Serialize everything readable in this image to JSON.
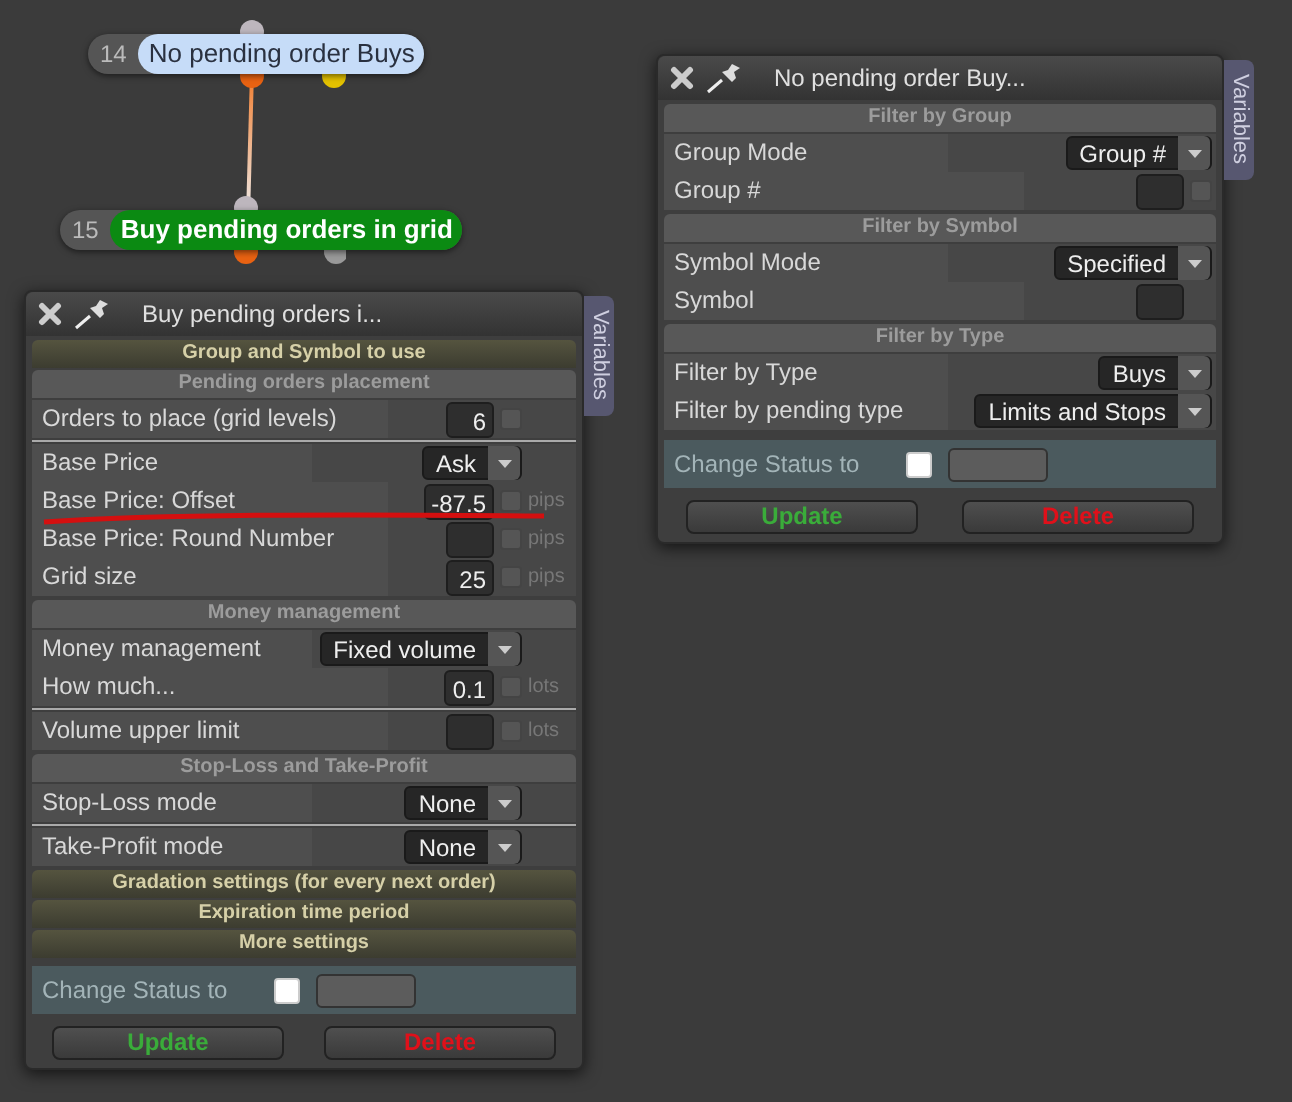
{
  "nodes": [
    {
      "number": "14",
      "label": "No pending order Buys",
      "kind": "condition"
    },
    {
      "number": "15",
      "label": "Buy pending orders in grid",
      "kind": "action"
    }
  ],
  "dialogs": [
    {
      "title": "Buy pending orders i...",
      "side_tab": "Variables",
      "sections": [
        {
          "heading": "Group and Symbol to use",
          "expanded": false
        },
        {
          "heading": "Pending orders placement",
          "expanded": true,
          "groups": [
            [
              {
                "kind": "number",
                "label": "Orders to place (grid levels)",
                "value": "6",
                "checked": false
              }
            ],
            [
              {
                "kind": "select",
                "label": "Base Price",
                "value": "Ask"
              },
              {
                "kind": "number",
                "label": "Base Price: Offset",
                "value": "-87.5",
                "checked": false,
                "unit": "pips"
              },
              {
                "kind": "number",
                "label": "Base Price: Round Number",
                "checked": false,
                "unit": "pips"
              },
              {
                "kind": "number",
                "label": "Grid size",
                "value": "25",
                "checked": false,
                "unit": "pips"
              }
            ]
          ]
        },
        {
          "heading": "Money management",
          "expanded": true,
          "groups": [
            [
              {
                "kind": "select",
                "label": "Money management",
                "value": "Fixed volume"
              },
              {
                "kind": "number",
                "label": "How much...",
                "value": "0.1",
                "checked": false,
                "unit": "lots"
              }
            ],
            [
              {
                "kind": "number",
                "label": "Volume upper limit",
                "checked": false,
                "unit": "lots"
              }
            ]
          ]
        },
        {
          "heading": "Stop-Loss and Take-Profit",
          "expanded": true,
          "groups": [
            [
              {
                "kind": "select",
                "label": "Stop-Loss mode",
                "value": "None"
              }
            ],
            [
              {
                "kind": "select",
                "label": "Take-Profit mode",
                "value": "None"
              }
            ]
          ]
        },
        {
          "heading": "Gradation settings (for every next order)",
          "expanded": false
        },
        {
          "heading": "Expiration time period",
          "expanded": false
        },
        {
          "heading": "More settings",
          "expanded": false
        }
      ],
      "change_status": {
        "label": "Change Status to",
        "checked": false
      },
      "buttons": [
        {
          "label": "Update",
          "kind": "update"
        },
        {
          "label": "Delete",
          "kind": "delete"
        }
      ]
    },
    {
      "title": "No pending order Buy...",
      "side_tab": "Variables",
      "sections": [
        {
          "heading": "Filter by Group",
          "expanded": true,
          "groups": [
            [
              {
                "kind": "select",
                "label": "Group Mode",
                "value": "Group #"
              },
              {
                "kind": "number",
                "label": "Group #",
                "checked": false
              }
            ]
          ]
        },
        {
          "heading": "Filter by Symbol",
          "expanded": true,
          "groups": [
            [
              {
                "kind": "select",
                "label": "Symbol Mode",
                "value": "Specified"
              },
              {
                "kind": "number",
                "label": "Symbol"
              }
            ]
          ]
        },
        {
          "heading": "Filter by Type",
          "expanded": true,
          "groups": [
            [
              {
                "kind": "select",
                "label": "Filter by Type",
                "value": "Buys"
              },
              {
                "kind": "select",
                "label": "Filter by pending type",
                "value": "Limits and Stops"
              }
            ]
          ]
        }
      ],
      "change_status": {
        "label": "Change Status to",
        "checked": false
      },
      "buttons": [
        {
          "label": "Update",
          "kind": "update"
        },
        {
          "label": "Delete",
          "kind": "delete"
        }
      ]
    }
  ]
}
